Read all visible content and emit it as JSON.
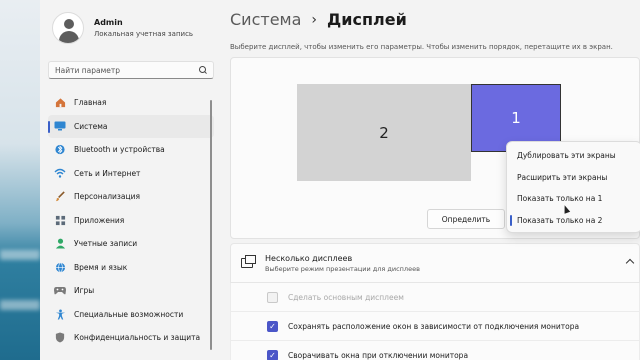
{
  "profile": {
    "name": "Admin",
    "subtitle": "Локальная учетная запись"
  },
  "search": {
    "placeholder": "Найти параметр"
  },
  "sidebar": {
    "items": [
      {
        "label": "Главная",
        "icon": "home-icon",
        "color": "#d4743a"
      },
      {
        "label": "Система",
        "icon": "system-icon",
        "color": "#2f86d1",
        "active": true
      },
      {
        "label": "Bluetooth и устройства",
        "icon": "bluetooth-icon",
        "color": "#2f86d1"
      },
      {
        "label": "Сеть и Интернет",
        "icon": "wifi-icon",
        "color": "#2f86d1"
      },
      {
        "label": "Персонализация",
        "icon": "brush-icon",
        "color": "#d48a3a"
      },
      {
        "label": "Приложения",
        "icon": "apps-icon",
        "color": "#5c6a79"
      },
      {
        "label": "Учетные записи",
        "icon": "person-icon",
        "color": "#2fa866"
      },
      {
        "label": "Время и язык",
        "icon": "globe-icon",
        "color": "#2f86d1"
      },
      {
        "label": "Игры",
        "icon": "gamepad-icon",
        "color": "#7a7a7a"
      },
      {
        "label": "Специальные возможности",
        "icon": "accessibility-icon",
        "color": "#2f86d1"
      },
      {
        "label": "Конфиденциальность и защита",
        "icon": "shield-icon",
        "color": "#7a7a7a"
      }
    ]
  },
  "header": {
    "section": "Система",
    "separator": "›",
    "page": "Дисплей"
  },
  "hint": "Выберите дисплей, чтобы изменить его параметры. Чтобы изменить порядок, перетащите их в экран.",
  "monitors": {
    "secondary_label": "2",
    "primary_label": "1",
    "identify_label": "Определить"
  },
  "colors": {
    "accent": "#4b56c8",
    "primary_monitor": "#6b6ae0"
  },
  "context_menu": {
    "items": [
      {
        "label": "Дублировать эти экраны"
      },
      {
        "label": "Расширить эти экраны"
      },
      {
        "label": "Показать только на 1"
      },
      {
        "label": "Показать только на 2",
        "selected": true
      }
    ]
  },
  "multi_display": {
    "title": "Несколько дисплеев",
    "subtitle": "Выберите режим презентации для дисплеев"
  },
  "options": [
    {
      "label": "Сделать основным дисплеем",
      "checked": false,
      "disabled": true
    },
    {
      "label": "Сохранять расположение окон в зависимости от подключения монитора",
      "checked": true
    },
    {
      "label": "Сворачивать окна при отключении монитора",
      "checked": true
    }
  ]
}
